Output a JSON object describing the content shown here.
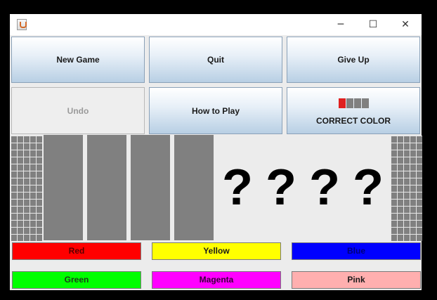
{
  "window": {
    "title_bar": {
      "minimize_glyph": "─",
      "maximize_glyph": "☐",
      "close_glyph": "✕"
    }
  },
  "toolbar": {
    "new_game": "New Game",
    "quit": "Quit",
    "give_up": "Give Up",
    "undo": "Undo",
    "how_to_play": "How to Play",
    "correct_color": "CORRECT COLOR"
  },
  "indicator": {
    "colors": [
      "#e02020",
      "#808080",
      "#808080",
      "#808080"
    ]
  },
  "hidden_code": [
    "?",
    "?",
    "?",
    "?"
  ],
  "color_buttons": [
    {
      "label": "Red",
      "bg": "#ff0000",
      "text": "#5a0000"
    },
    {
      "label": "Yellow",
      "bg": "#ffff00",
      "text": "#1a1a1a"
    },
    {
      "label": "Blue",
      "bg": "#0000ff",
      "text": "#00007a"
    },
    {
      "label": "Green",
      "bg": "#00ff00",
      "text": "#1a3a1a"
    },
    {
      "label": "Magenta",
      "bg": "#ff00ff",
      "text": "#3a003a"
    },
    {
      "label": "Pink",
      "bg": "#ffafaf",
      "text": "#1a1a1a"
    }
  ]
}
